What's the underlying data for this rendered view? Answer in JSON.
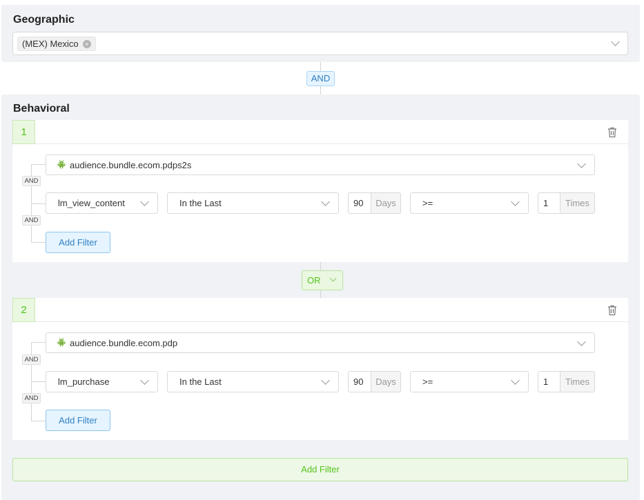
{
  "geographic": {
    "title": "Geographic",
    "selected_tags": [
      "(MEX) Mexico"
    ],
    "tag_close_glyph": "×"
  },
  "connector_and": "AND",
  "behavioral": {
    "title": "Behavioral",
    "or_label": "OR",
    "add_filter_wide_label": "Add Filter",
    "groups": [
      {
        "number": "1",
        "app_bundle": "audience.bundle.ecom.pdps2s",
        "and_labels": [
          "AND",
          "AND"
        ],
        "event": "lm_view_content",
        "time_condition": "In the Last",
        "days_value": "90",
        "days_label": "Days",
        "operator": ">=",
        "times_value": "1",
        "times_label": "Times",
        "add_filter_label": "Add Filter"
      },
      {
        "number": "2",
        "app_bundle": "audience.bundle.ecom.pdp",
        "and_labels": [
          "AND",
          "AND"
        ],
        "event": "lm_purchase",
        "time_condition": "In the Last",
        "days_value": "90",
        "days_label": "Days",
        "operator": ">=",
        "times_value": "1",
        "times_label": "Times",
        "add_filter_label": "Add Filter"
      }
    ]
  },
  "colors": {
    "panel_bg": "#f0f2f5",
    "accent_blue": "#2f80c2",
    "accent_green": "#52c41a",
    "android_green": "#7cb342"
  },
  "icons": {
    "trash": "trash-icon",
    "chevron": "chevron-down-icon",
    "android": "android-icon",
    "tag_close": "close-circle-icon"
  }
}
